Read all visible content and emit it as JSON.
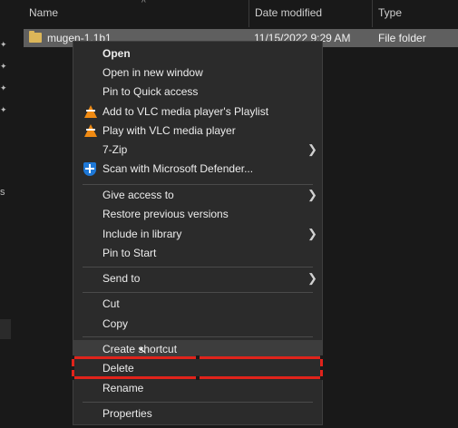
{
  "columns": {
    "name": "Name",
    "date_modified": "Date modified",
    "type": "Type"
  },
  "file": {
    "name": "mugen-1.1b1",
    "date": "11/15/2022 9:29 AM",
    "type": "File folder"
  },
  "context_menu": {
    "items": [
      {
        "label": "Open"
      },
      {
        "label": "Open in new window"
      },
      {
        "label": "Pin to Quick access"
      },
      {
        "label": "Add to VLC media player's Playlist"
      },
      {
        "label": "Play with VLC media player"
      },
      {
        "label": "7-Zip"
      },
      {
        "label": "Scan with Microsoft Defender..."
      },
      {
        "label": "Give access to"
      },
      {
        "label": "Restore previous versions"
      },
      {
        "label": "Include in library"
      },
      {
        "label": "Pin to Start"
      },
      {
        "label": "Send to"
      },
      {
        "label": "Cut"
      },
      {
        "label": "Copy"
      },
      {
        "label": "Create shortcut"
      },
      {
        "label": "Delete"
      },
      {
        "label": "Rename"
      },
      {
        "label": "Properties"
      }
    ]
  },
  "highlight_color": "#e0231b",
  "nav_pin_icon": "pin-icon"
}
